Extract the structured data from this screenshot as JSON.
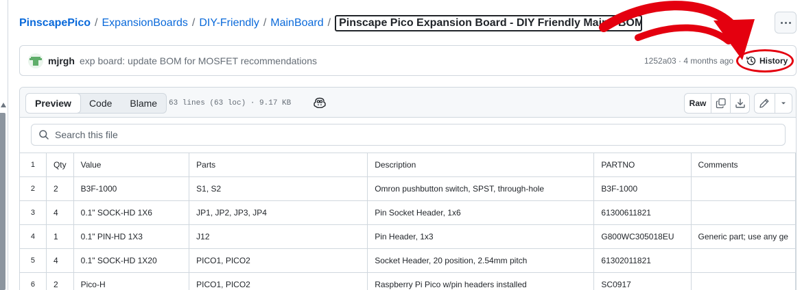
{
  "breadcrumb": {
    "root": "PinscapePico",
    "parts": [
      "ExpansionBoards",
      "DIY-Friendly",
      "MainBoard"
    ],
    "current": "Pinscape Pico Expansion Board - DIY Friendly Main - BOM.csv"
  },
  "commit": {
    "author": "mjrgh",
    "message": "exp board: update BOM for MOSFET recommendations",
    "sha": "1252a03",
    "age": "4 months ago",
    "history_label": "History"
  },
  "file": {
    "tabs": [
      "Preview",
      "Code",
      "Blame"
    ],
    "active_tab": "Preview",
    "info": "63 lines (63 loc) · 9.17 KB",
    "raw_label": "Raw",
    "search_placeholder": "Search this file"
  },
  "table": {
    "line_numbers": [
      "1",
      "2",
      "3",
      "4",
      "5",
      "6"
    ],
    "header": [
      "Qty",
      "Value",
      "Parts",
      "Description",
      "PARTNO",
      "Comments"
    ],
    "rows": [
      [
        "2",
        "B3F-1000",
        "S1, S2",
        "Omron pushbutton switch, SPST, through-hole",
        "B3F-1000",
        ""
      ],
      [
        "4",
        "0.1\" SOCK-HD 1X6",
        "JP1, JP2, JP3, JP4",
        "Pin Socket Header, 1x6",
        "61300611821",
        ""
      ],
      [
        "1",
        "0.1\" PIN-HD 1X3",
        "J12",
        "Pin Header, 1x3",
        "G800WC305018EU",
        "Generic part; use any ge"
      ],
      [
        "4",
        "0.1\" SOCK-HD 1X20",
        "PICO1, PICO2",
        "Socket Header, 20 position, 2.54mm pitch",
        "61302011821",
        ""
      ],
      [
        "2",
        "Pico-H",
        "PICO1, PICO2",
        "Raspberry Pi Pico w/pin headers installed",
        "SC0917",
        ""
      ]
    ]
  },
  "colors": {
    "link": "#0969da",
    "annotation": "#e4000f",
    "border": "#d0d7de"
  },
  "icons": [
    "more-icon",
    "avatar",
    "history-icon",
    "copilot-icon",
    "copy-icon",
    "download-icon",
    "pencil-icon",
    "chevron-down-icon",
    "search-icon"
  ]
}
